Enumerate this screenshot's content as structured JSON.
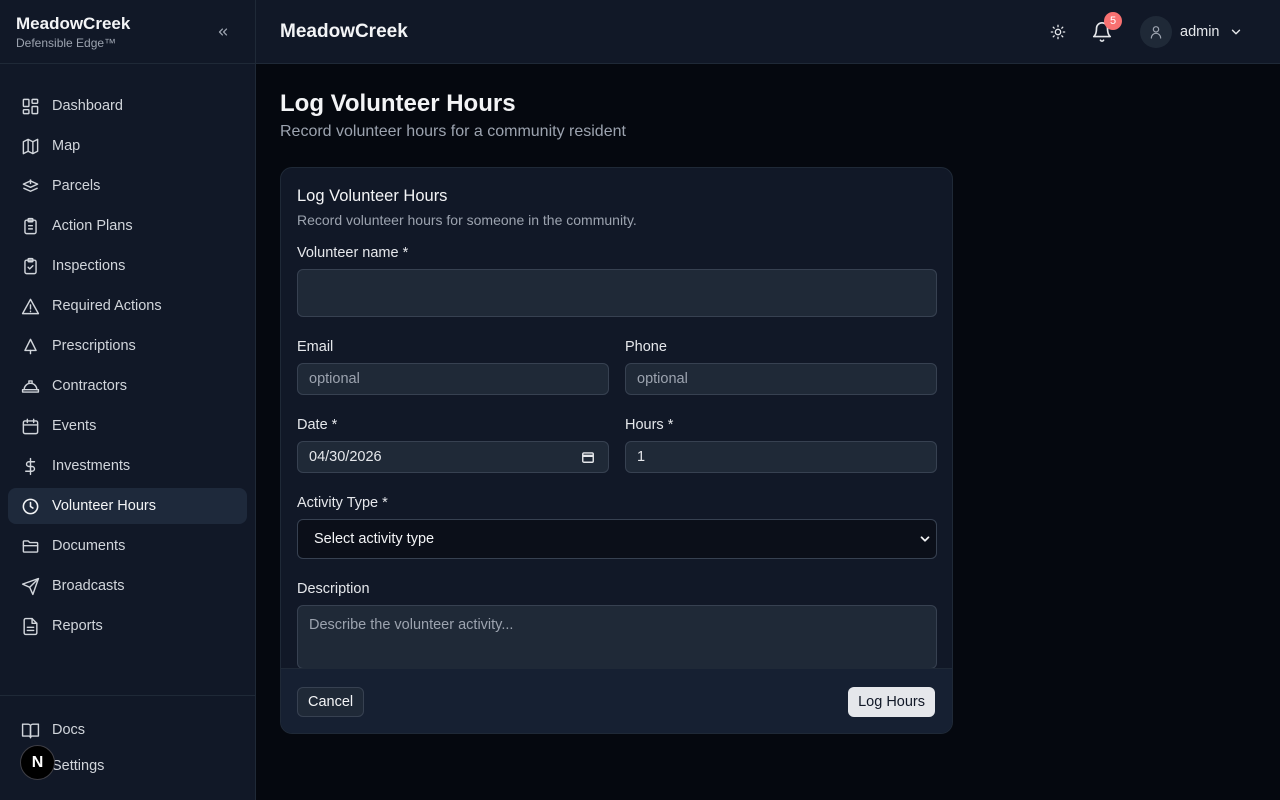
{
  "sidebar": {
    "brand_title": "MeadowCreek",
    "brand_sub": "Defensible Edge™",
    "items": [
      {
        "label": "Dashboard",
        "icon": "dashboard-icon"
      },
      {
        "label": "Map",
        "icon": "map-icon"
      },
      {
        "label": "Parcels",
        "icon": "parcels-icon"
      },
      {
        "label": "Action Plans",
        "icon": "clipboard-icon"
      },
      {
        "label": "Inspections",
        "icon": "clipboard-check-icon"
      },
      {
        "label": "Required Actions",
        "icon": "warning-icon"
      },
      {
        "label": "Prescriptions",
        "icon": "tree-icon"
      },
      {
        "label": "Contractors",
        "icon": "hard-hat-icon"
      },
      {
        "label": "Events",
        "icon": "calendar-icon"
      },
      {
        "label": "Investments",
        "icon": "dollar-icon"
      },
      {
        "label": "Volunteer Hours",
        "icon": "clock-icon"
      },
      {
        "label": "Documents",
        "icon": "folder-icon"
      },
      {
        "label": "Broadcasts",
        "icon": "send-icon"
      },
      {
        "label": "Reports",
        "icon": "file-text-icon"
      }
    ],
    "active": "Volunteer Hours",
    "bottom": [
      {
        "label": "Docs",
        "icon": "book-icon"
      },
      {
        "label": "Settings",
        "icon": "settings-icon"
      }
    ],
    "n_badge": "N"
  },
  "header": {
    "title": "MeadowCreek",
    "notification_count": "5",
    "user_name": "admin"
  },
  "page": {
    "title": "Log Volunteer Hours",
    "subtitle": "Record volunteer hours for a community resident"
  },
  "form": {
    "title": "Log Volunteer Hours",
    "subtitle": "Record volunteer hours for someone in the community.",
    "volunteer_label": "Volunteer name *",
    "volunteer_value": "",
    "email_label": "Email",
    "email_placeholder": "optional",
    "phone_label": "Phone",
    "phone_placeholder": "optional",
    "date_label": "Date *",
    "date_value": "04/30/2026",
    "hours_label": "Hours *",
    "hours_value": "1",
    "activity_label": "Activity Type *",
    "activity_value": "Select activity type",
    "description_label": "Description",
    "description_placeholder": "Describe the volunteer activity...",
    "cancel_label": "Cancel",
    "submit_label": "Log Hours"
  },
  "colors": {
    "background": "#05080f",
    "sidebar": "#111827",
    "active_item": "#1e293b",
    "badge": "#f87171"
  }
}
